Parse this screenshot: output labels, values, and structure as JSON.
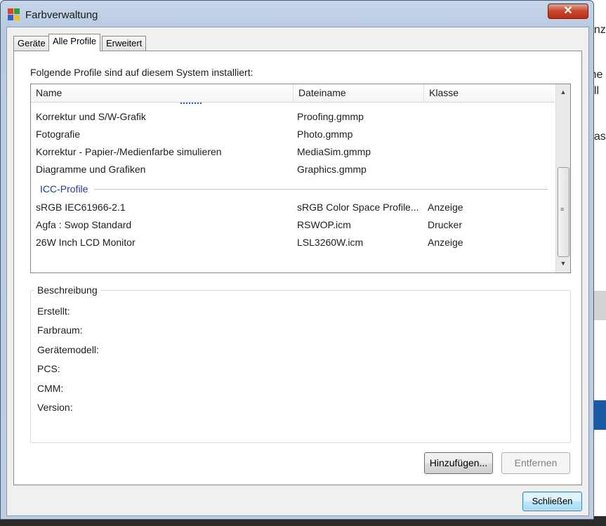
{
  "background_text": [
    "anz",
    "ine",
    "ell",
    "das"
  ],
  "window": {
    "title": "Farbverwaltung",
    "close_glyph": "✕"
  },
  "tabs": [
    {
      "label": "Geräte",
      "active": false
    },
    {
      "label": "Alle Profile",
      "active": true
    },
    {
      "label": "Erweitert",
      "active": false
    }
  ],
  "intro_text": "Folgende Profile sind auf diesem System installiert:",
  "list": {
    "columns": [
      "Name",
      "Dateiname",
      "Klasse"
    ],
    "wcs_rows": [
      {
        "name": "Korrektur und S/W-Grafik",
        "file": "Proofing.gmmp",
        "class": ""
      },
      {
        "name": "Fotografie",
        "file": "Photo.gmmp",
        "class": ""
      },
      {
        "name": "Korrektur - Papier-/Medienfarbe simulieren",
        "file": "MediaSim.gmmp",
        "class": ""
      },
      {
        "name": "Diagramme und Grafiken",
        "file": "Graphics.gmmp",
        "class": ""
      }
    ],
    "icc_group_label": "ICC-Profile",
    "icc_rows": [
      {
        "name": "sRGB IEC61966-2.1",
        "file": "sRGB Color Space Profile...",
        "class": "Anzeige"
      },
      {
        "name": "Agfa : Swop Standard",
        "file": "RSWOP.icm",
        "class": "Drucker"
      },
      {
        "name": "26W Inch LCD Monitor",
        "file": "LSL3260W.icm",
        "class": "Anzeige"
      }
    ]
  },
  "description": {
    "legend": "Beschreibung",
    "fields": [
      "Erstellt:",
      "Farbraum:",
      "Gerätemodell:",
      "PCS:",
      "CMM:",
      "Version:"
    ]
  },
  "buttons": {
    "add": "Hinzufügen...",
    "remove": "Entfernen",
    "close": "Schließen"
  },
  "colors": {
    "group_header": "#1e3f90",
    "close_button": "#c8442a",
    "disabled_text": "#838383"
  }
}
